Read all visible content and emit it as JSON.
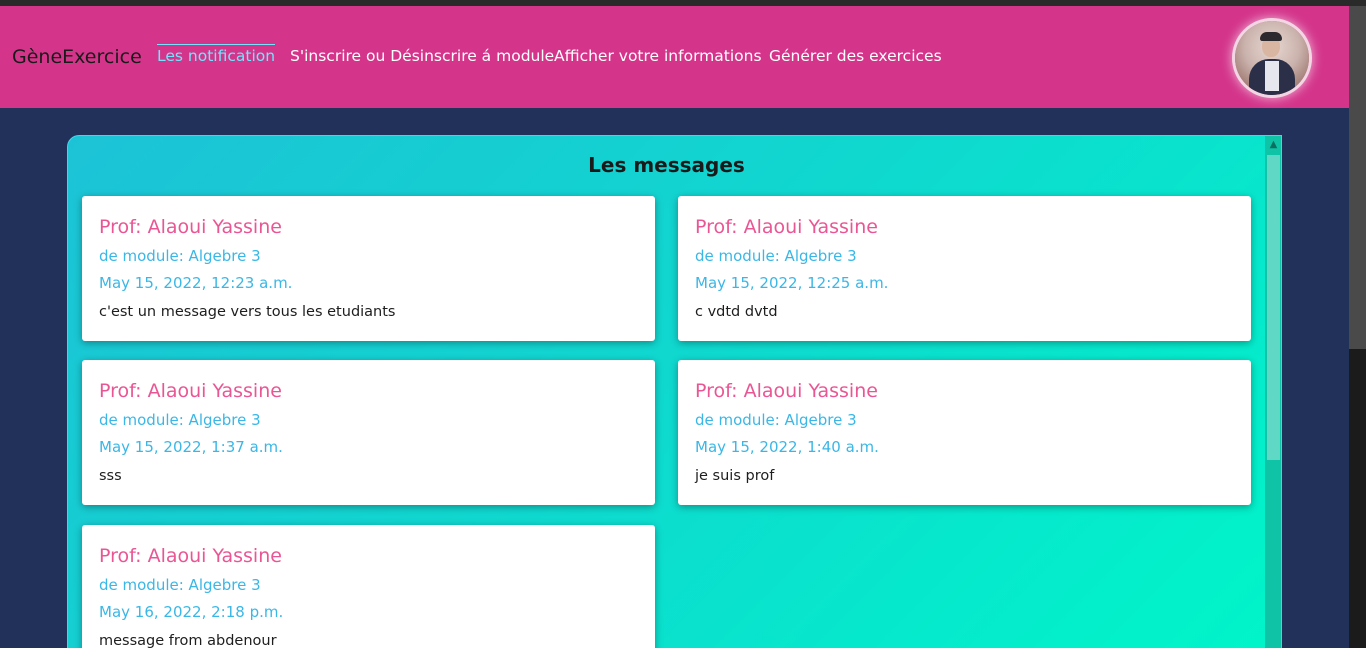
{
  "navbar": {
    "brand": "GèneExercice",
    "links": [
      {
        "label": "Les notification",
        "active": true
      },
      {
        "label": "S'inscrire ou Désinscrire á module",
        "active": false
      },
      {
        "label": "Afficher votre informations",
        "active": false
      },
      {
        "label": "Générer des exercices",
        "active": false
      }
    ],
    "avatar_icon": "user-avatar-photo"
  },
  "main": {
    "title": "Les messages",
    "messages": [
      {
        "prof": "Prof: Alaoui Yassine",
        "module": "de module: Algebre 3",
        "date": "May 15, 2022, 12:23 a.m.",
        "text": "c'est un message vers tous les etudiants"
      },
      {
        "prof": "Prof: Alaoui Yassine",
        "module": "de module: Algebre 3",
        "date": "May 15, 2022, 12:25 a.m.",
        "text": "c vdtd dvtd"
      },
      {
        "prof": "Prof: Alaoui Yassine",
        "module": "de module: Algebre 3",
        "date": "May 15, 2022, 1:37 a.m.",
        "text": "sss"
      },
      {
        "prof": "Prof: Alaoui Yassine",
        "module": "de module: Algebre 3",
        "date": "May 15, 2022, 1:40 a.m.",
        "text": "je suis prof"
      },
      {
        "prof": "Prof: Alaoui Yassine",
        "module": "de module: Algebre 3",
        "date": "May 16, 2022, 2:18 p.m.",
        "text": "message from abdenour"
      }
    ]
  },
  "colors": {
    "navbar": "#d4358b",
    "background": "#223159",
    "prof_text": "#ea5694",
    "meta_text": "#3ab7e6",
    "active_link": "#6fe6ff"
  }
}
